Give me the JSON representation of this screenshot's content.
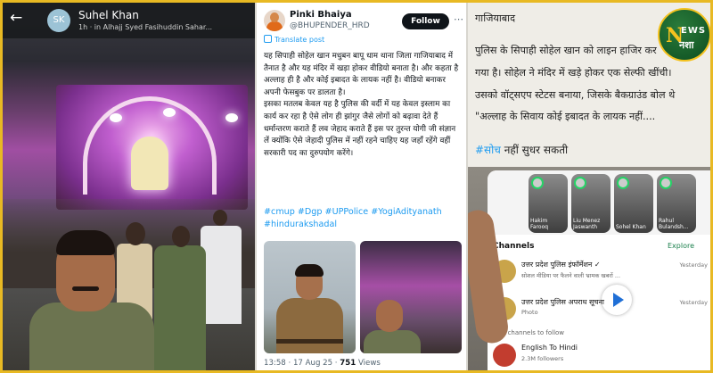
{
  "status_view": {
    "avatar_initials": "SK",
    "contact_name": "Suhel Khan",
    "status_meta": "1h · in Alhajj Syed Fasihuddin Sahar..."
  },
  "tweet": {
    "display_name": "Pinki Bhaiya",
    "handle": "@BHUPENDER_HRD",
    "follow_label": "Follow",
    "translate_label": "Translate post",
    "body_paragraph_1": "यह सिपाही सोहेल खान मधुबन बापू धाम थाना जिला गाजियाबाद में तैनात है और यह मंदिर में खड़ा होकर वीडियो बनाता है। और कहता है अल्लाह ही है और कोई इबादत के लायक नहीं है। वीडियो बनाकर अपनी फेसबुक पर डालता है।",
    "body_paragraph_2": "इसका मतलब केवल यह है पुलिस की वर्दी में यह केवल इस्लाम का कार्य कर रहा है ऐसे लोग ही झांगुर जैसे लोगों को बढ़ावा देते हैं धर्मान्तरण कराते हैं लव जेहाद कराते हैं इस पर तुरन्त योगी जी संज्ञान लें क्योंकि ऐसे जेहादी पुलिस में नहीं रहने चाहिए यह जहाँ रहेंगे वहीं सरकारी पद का दुरुपयोग करेंगे।",
    "hashtags": "#cmup #Dgp #UPPolice #YogiAdityanath #hindurakshadal",
    "timestamp": "13:58 · 17 Aug 25 ·",
    "view_count": "751",
    "views_label": "Views"
  },
  "news_excerpt": {
    "line_1": "गाजियाबाद",
    "line_2": "पुलिस के सिपाही सोहेल खान को लाइन हाजिर कर",
    "line_3": "गया है। सोहेल ने मंदिर में खड़े होकर एक सेल्फी खींची।",
    "line_4": "उसको वॉट्सएप स्टेटस बनाया, जिसके बैकग्राउंड बोल थे",
    "line_5": "\"अल्लाह के सिवाय कोई इबादत के लायक नहीं....",
    "hashtag": "#सोच",
    "hashtag_rest": " नहीं सुधर सकती"
  },
  "phone": {
    "stories": [
      {
        "name": "Hakim Farooq"
      },
      {
        "name": "Liu Menez Jaswanth"
      },
      {
        "name": "Sohel Khan"
      },
      {
        "name": "Rahul Bulandsh..."
      }
    ],
    "channels_label": "Channels",
    "explore_label": "Explore",
    "channel_1_title": "उत्तर प्रदेश पुलिस इंफॉर्मेशन ✓",
    "channel_1_sub": "सोशल मीडिया पर फैलने वाली भ्रामक खबरों ...",
    "channel_1_time": "Yesterday",
    "channel_2_title": "उत्तर प्रदेश पुलिस अपराध सूचना",
    "channel_2_sub": "Photo",
    "channel_2_time": "Yesterday",
    "find_channels_label": "Find channels to follow",
    "channel_3_title": "English To Hindi",
    "channel_3_sub": "2.3M followers"
  },
  "logo": {
    "letter": "N",
    "latin": "EWS",
    "hindi": "नशा"
  },
  "colors": {
    "frame_border": "#e8b923",
    "twitter_blue": "#1d9bf0",
    "logo_green": "#155b28",
    "logo_gold": "#f4c21f"
  }
}
